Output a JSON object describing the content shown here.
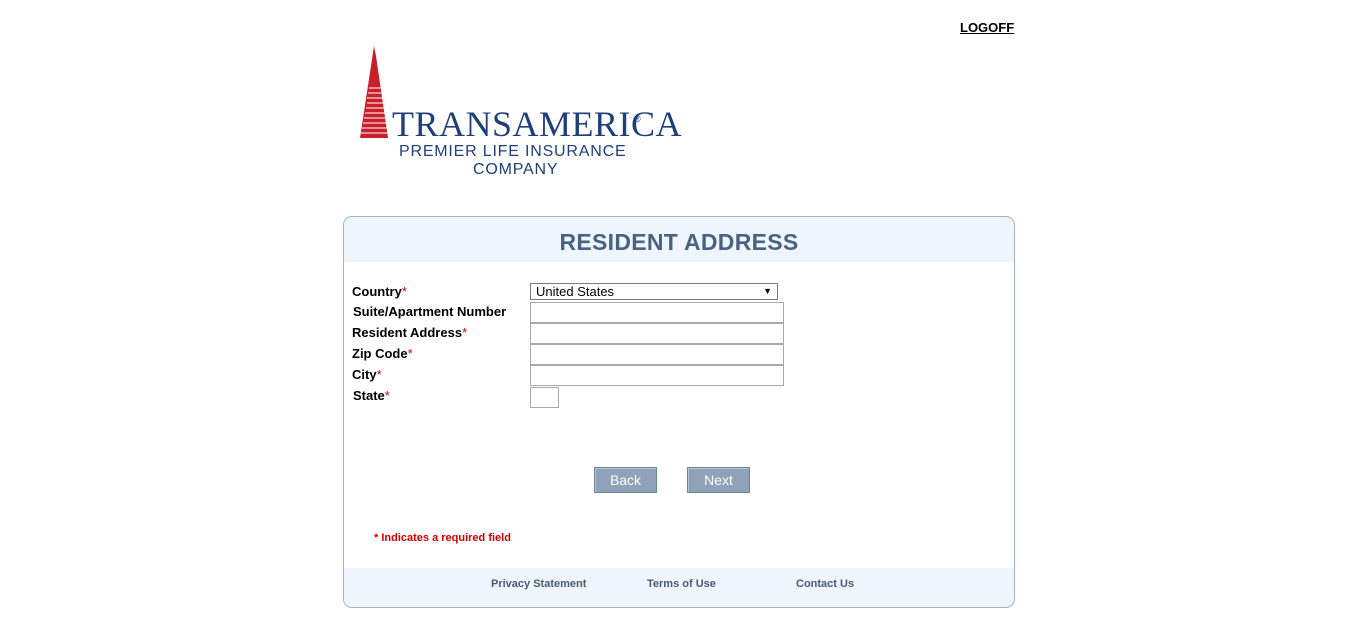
{
  "header": {
    "logoff_label": "LOGOFF"
  },
  "logo": {
    "brand": "TRANSAMERICA",
    "registered": "®",
    "subtitle_line1": "PREMIER LIFE INSURANCE",
    "subtitle_line2": "COMPANY",
    "colors": {
      "brand_blue": "#1f3f7a",
      "tower_red": "#c8202a"
    }
  },
  "form": {
    "title": "RESIDENT ADDRESS",
    "required_marker": "*",
    "fields": {
      "country": {
        "label": "Country",
        "required": true,
        "value": "United States"
      },
      "suite": {
        "label": "Suite/Apartment Number",
        "required": false,
        "value": ""
      },
      "address": {
        "label": "Resident Address",
        "required": true,
        "value": ""
      },
      "zip": {
        "label": "Zip Code",
        "required": true,
        "value": ""
      },
      "city": {
        "label": "City",
        "required": true,
        "value": ""
      },
      "state": {
        "label": "State",
        "required": true,
        "value": ""
      }
    },
    "back_label": "Back",
    "next_label": "Next",
    "required_note": "* Indicates a required field"
  },
  "footer": {
    "privacy_label": "Privacy Statement",
    "terms_label": "Terms of Use",
    "contact_label": "Contact Us"
  },
  "colors": {
    "panel_bg": "#eef5fc",
    "title_color": "#4a6282",
    "button_bg": "#8ea2b8",
    "required_red": "#d60000"
  }
}
